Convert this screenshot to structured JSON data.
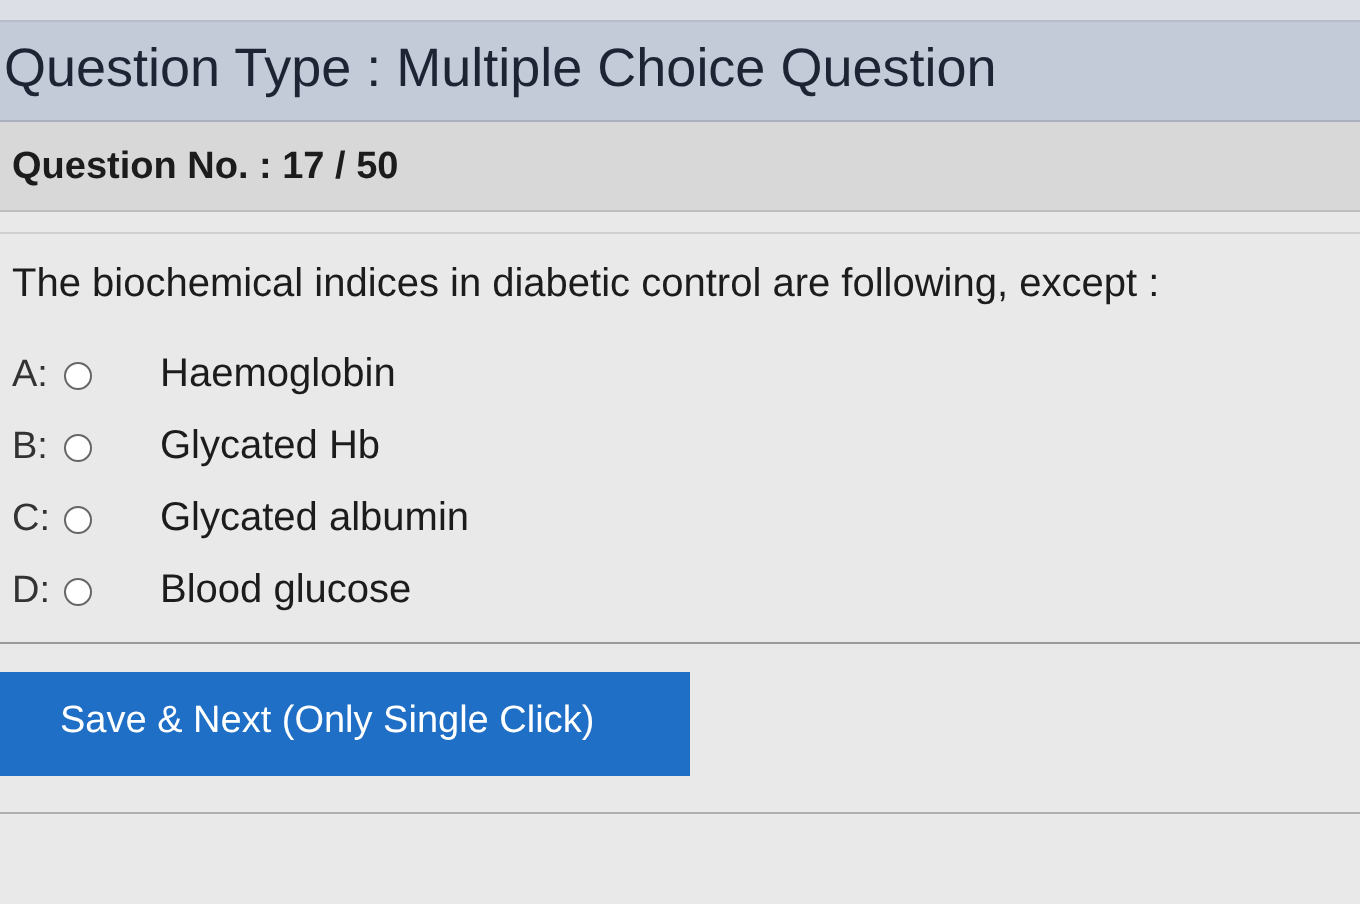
{
  "header": {
    "title": "Question Type : Multiple Choice Question"
  },
  "question_number": {
    "label": "Question No. : 17 / 50"
  },
  "question": {
    "text": "The biochemical indices in diabetic control are following, except :"
  },
  "options": [
    {
      "letter": "A:",
      "text": "Haemoglobin",
      "selected": false
    },
    {
      "letter": "B:",
      "text": "Glycated Hb",
      "selected": false
    },
    {
      "letter": "C:",
      "text": "Glycated albumin",
      "selected": false
    },
    {
      "letter": "D:",
      "text": "Blood glucose",
      "selected": false
    }
  ],
  "buttons": [
    {
      "label": "Save & Next (Only Single Click)"
    }
  ]
}
